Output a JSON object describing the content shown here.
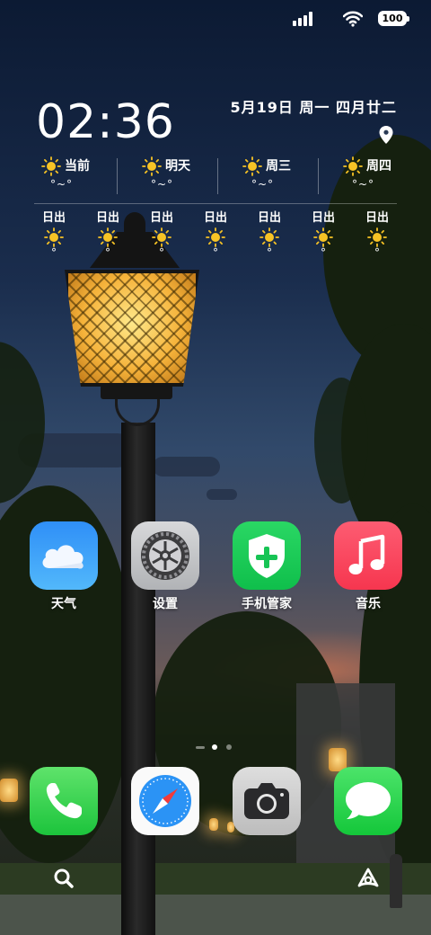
{
  "status_bar": {
    "battery": "100"
  },
  "clock": {
    "time": "02:36",
    "date": "5月19日 周一 四月廿二"
  },
  "forecast": [
    {
      "label": "当前",
      "temp": "°~°"
    },
    {
      "label": "明天",
      "temp": "°~°"
    },
    {
      "label": "周三",
      "temp": "°~°"
    },
    {
      "label": "周四",
      "temp": "°~°"
    }
  ],
  "hourly": [
    {
      "label": "日出",
      "temp": "°"
    },
    {
      "label": "日出",
      "temp": "°"
    },
    {
      "label": "日出",
      "temp": "°"
    },
    {
      "label": "日出",
      "temp": "°"
    },
    {
      "label": "日出",
      "temp": "°"
    },
    {
      "label": "日出",
      "temp": "°"
    },
    {
      "label": "日出",
      "temp": "°"
    }
  ],
  "apps": [
    {
      "label": "天气",
      "icon": "weather-icon"
    },
    {
      "label": "设置",
      "icon": "settings-icon"
    },
    {
      "label": "手机管家",
      "icon": "phone-manager-icon"
    },
    {
      "label": "音乐",
      "icon": "music-icon"
    }
  ],
  "dock": [
    {
      "icon": "phone-icon"
    },
    {
      "icon": "safari-icon"
    },
    {
      "icon": "camera-icon"
    },
    {
      "icon": "messages-icon"
    }
  ],
  "page_indicator": {
    "pages": 3,
    "current": 2
  },
  "colors": {
    "weather": "#2f8ff7",
    "manager": "#1cc94f",
    "music": "#f94460",
    "phone": "#2fd14a",
    "sun": "#f7c325"
  }
}
